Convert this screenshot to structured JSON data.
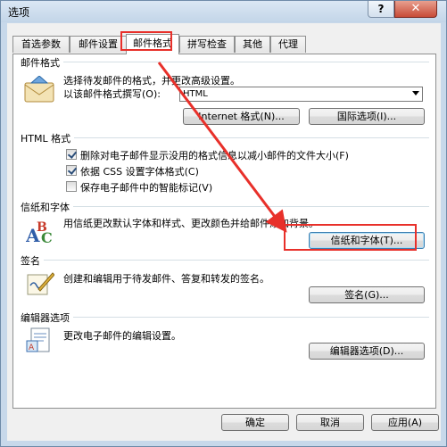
{
  "window": {
    "title": "选项",
    "help_label": "?",
    "close_label": "✕"
  },
  "tabs": [
    {
      "label": "首选参数",
      "active": false
    },
    {
      "label": "邮件设置",
      "active": false
    },
    {
      "label": "邮件格式",
      "active": true
    },
    {
      "label": "拼写检查",
      "active": false
    },
    {
      "label": "其他",
      "active": false
    },
    {
      "label": "代理",
      "active": false
    }
  ],
  "mail_format": {
    "section_title": "邮件格式",
    "description": "选择待发邮件的格式，并更改高级设置。",
    "compose_label": "以该邮件格式撰写(O):",
    "compose_value": "HTML",
    "internet_format_button": "Internet 格式(N)...",
    "international_button": "国际选项(I)..."
  },
  "html_format": {
    "section_title": "HTML 格式",
    "options": [
      {
        "label": "删除对电子邮件显示没用的格式信息以减小邮件的文件大小(F)",
        "checked": true
      },
      {
        "label": "依据 CSS 设置字体格式(C)",
        "checked": true
      },
      {
        "label": "保存电子邮件中的智能标记(V)",
        "checked": false
      }
    ]
  },
  "stationery": {
    "section_title": "信纸和字体",
    "description": "用信纸更改默认字体和样式、更改颜色并给邮件添加背景。",
    "button": "信纸和字体(T)..."
  },
  "signature": {
    "section_title": "签名",
    "description": "创建和编辑用于待发邮件、答复和转发的签名。",
    "button": "签名(G)..."
  },
  "editor": {
    "section_title": "编辑器选项",
    "description": "更改电子邮件的编辑设置。",
    "button": "编辑器选项(D)..."
  },
  "footer": {
    "ok": "确定",
    "cancel": "取消",
    "apply": "应用(A)"
  },
  "annotation": {
    "color": "#e8302a"
  },
  "icons": [
    "envelope-icon",
    "font-abc-icon",
    "signature-pen-icon",
    "editor-document-icon"
  ]
}
